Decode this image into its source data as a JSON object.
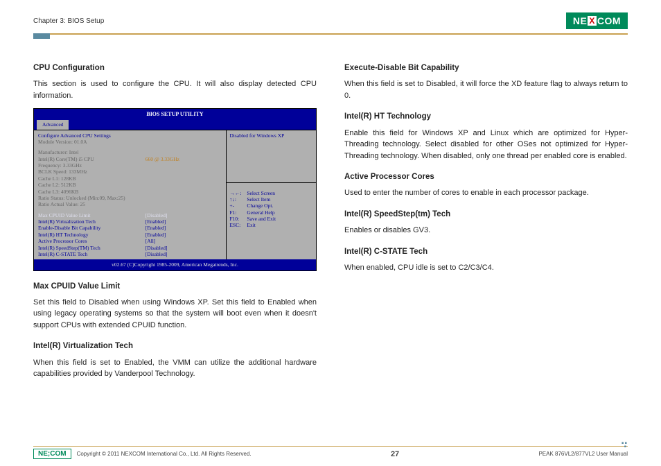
{
  "header": {
    "chapter": "Chapter 3: BIOS Setup",
    "logo": "NE COM",
    "logo_x": "X"
  },
  "left": {
    "h1": "CPU Configuration",
    "p1": "This section is used to configure the CPU. It will also display detected CPU information.",
    "h2": "Max CPUID Value Limit",
    "p2": "Set this field to Disabled when using Windows XP. Set this field to Enabled when using legacy operating systems so that the system will boot even when it doesn't support CPUs with extended CPUID function.",
    "h3": "Intel(R) Virtualization Tech",
    "p3": "When this field is set to Enabled, the VMM can utilize the additional hardware capabilities provided by Vanderpool Technology."
  },
  "right": {
    "h1": "Execute-Disable Bit Capability",
    "p1": "When this field is set to Disabled, it will force the XD feature flag to always return to 0.",
    "h2": "Intel(R) HT Technology",
    "p2": "Enable this field for Windows XP and Linux which are optimized for Hyper-Threading technology. Select disabled for other OSes not optimized for Hyper-Threading technology. When disabled, only one thread per enabled core is enabled.",
    "h3": "Active Processor Cores",
    "p3": "Used to enter the number of cores to enable in each processor package.",
    "h4": "Intel(R) SpeedStep(tm) Tech",
    "p4": "Enables or disables GV3.",
    "h5": "Intel(R) C-STATE Tech",
    "p5": "When enabled, CPU idle is set to C2/C3/C4."
  },
  "bios": {
    "title": "BIOS SETUP UTILITY",
    "tab": "Advanced",
    "line1": "Configure Advanced CPU Settings",
    "line2": "Module Version: 01.0A",
    "mfr": "Manufacturer: Intel",
    "cpu": "Intel(R) Core(TM) i5 CPU",
    "cpu_speed": "660 @ 3.33GHz",
    "freq": "Frequency: 3.33GHz",
    "bclk": "BCLK Speed: 133MHz",
    "l1": "Cache L1: 128KB",
    "l2": "Cache L2: 512KB",
    "l3": "Cache L3: 4096KB",
    "ratio": "Ratio Status: Unlocked (Min:09, Max:25)",
    "ratio2": "Ratio Actual Value: 25",
    "settings": [
      {
        "label": "Max CPUID Value Limit",
        "value": "[Disabled]"
      },
      {
        "label": "Intel(R) Virtualization Tech",
        "value": "[Enabled]"
      },
      {
        "label": "Enable-Disable Bit Capability",
        "value": "[Enabled]"
      },
      {
        "label": "Intel(R) HT Technology",
        "value": "[Enabled]"
      },
      {
        "label": "Active Processor Cores",
        "value": "[All]"
      },
      {
        "label": "Intel(R) SpeedStep(TM) Tech",
        "value": "[Disabled]"
      },
      {
        "label": "Intel(R) C-STATE Tech",
        "value": "[Disabled]"
      }
    ],
    "right_note": "Disabled for Windows XP",
    "help": [
      {
        "k": "→←:",
        "t": "Select Screen"
      },
      {
        "k": "↑↓:",
        "t": "Select Item"
      },
      {
        "k": "+-",
        "t": "Change Opt."
      },
      {
        "k": "F1:",
        "t": "General Help"
      },
      {
        "k": "F10:",
        "t": "Save and Exit"
      },
      {
        "k": "ESC:",
        "t": "Exit"
      }
    ],
    "footer": "v02.67 (C)Copyright 1985-2009, American Megatrends, Inc."
  },
  "footer": {
    "logo": "NE;COM",
    "copyright": "Copyright © 2011 NEXCOM International Co., Ltd. All Rights Reserved.",
    "page": "27",
    "doc": "PEAK 876VL2/877VL2 User Manual"
  }
}
